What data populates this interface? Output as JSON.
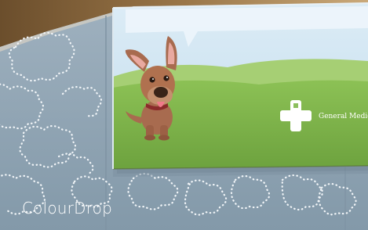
{
  "caption": "ColourDrop",
  "sign": {
    "text": "General Medica"
  },
  "colors": {
    "wall": "#93a7b6",
    "dots": "#f1f5f8",
    "sky": "#cfe6f3",
    "grass": "#7fb84c",
    "dog_body": "#a86b4f",
    "dog_ear_inner": "#e9a9a0",
    "tongue": "#f07a8a",
    "cross": "#ffffff",
    "ceiling_wood": "#7b5a33"
  },
  "icons": {
    "dog": "cartoon-dog-illustration",
    "cross": "medical-cross-logo"
  }
}
